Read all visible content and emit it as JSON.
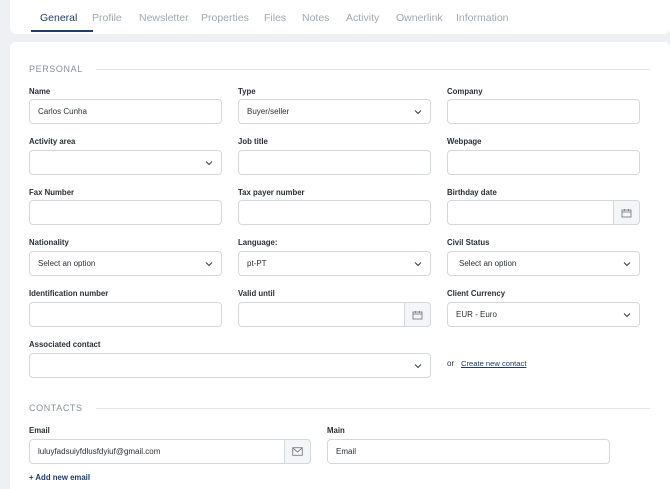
{
  "tabs": [
    "General",
    "Profile",
    "Newsletter",
    "Properties",
    "Files",
    "Notes",
    "Activity",
    "Ownerlink",
    "Information"
  ],
  "sections": {
    "personal": "PERSONAL",
    "contacts": "CONTACTS"
  },
  "fields": {
    "name": {
      "label": "Name",
      "value": "Carlos Cunha"
    },
    "type": {
      "label": "Type",
      "value": "Buyer/seller"
    },
    "company": {
      "label": "Company",
      "value": ""
    },
    "activity_area": {
      "label": "Activity area",
      "value": ""
    },
    "job_title": {
      "label": "Job title",
      "value": ""
    },
    "webpage": {
      "label": "Webpage",
      "value": ""
    },
    "fax_number": {
      "label": "Fax Number",
      "value": ""
    },
    "tax_payer_number": {
      "label": "Tax payer number",
      "value": ""
    },
    "birthday_date": {
      "label": "Birthday date",
      "value": ""
    },
    "nationality": {
      "label": "Nationality",
      "value": "Select an option"
    },
    "language": {
      "label": "Language:",
      "value": "pt-PT"
    },
    "civil_status": {
      "label": "Civil Status",
      "value": "Select an option"
    },
    "identification_number": {
      "label": "Identification number",
      "value": ""
    },
    "valid_until": {
      "label": "Valid until",
      "value": ""
    },
    "client_currency": {
      "label": "Client Currency",
      "value": "EUR - Euro"
    },
    "associated_contact": {
      "label": "Associated contact",
      "value": ""
    }
  },
  "associated": {
    "or": "or",
    "create_link": "Create new contact"
  },
  "contacts": {
    "email_label": "Email",
    "email_value": "luluyfadsuiyfdlusfdyiuf@gmail.com",
    "main_label": "Main",
    "main_value": "Email",
    "add_email": "+ Add new email"
  },
  "colors": {
    "accent": "#1f3c6b",
    "background": "#eef0f3",
    "border": "#d4d8de"
  },
  "icons": [
    "chevron-down-icon",
    "calendar-icon",
    "envelope-icon"
  ]
}
